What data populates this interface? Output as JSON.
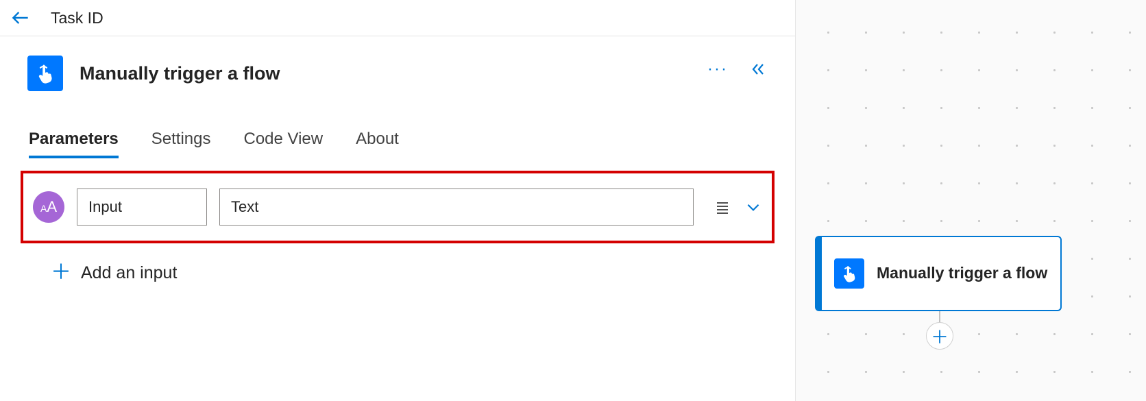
{
  "header": {
    "page_title": "Task ID"
  },
  "panel": {
    "trigger_title": "Manually trigger a flow"
  },
  "tabs": {
    "parameters": "Parameters",
    "settings": "Settings",
    "code_view": "Code View",
    "about": "About"
  },
  "input_row": {
    "type_badge": "AA",
    "name": "Input",
    "value": "Text"
  },
  "add_input_label": "Add an input",
  "canvas": {
    "node_title": "Manually trigger a flow"
  }
}
